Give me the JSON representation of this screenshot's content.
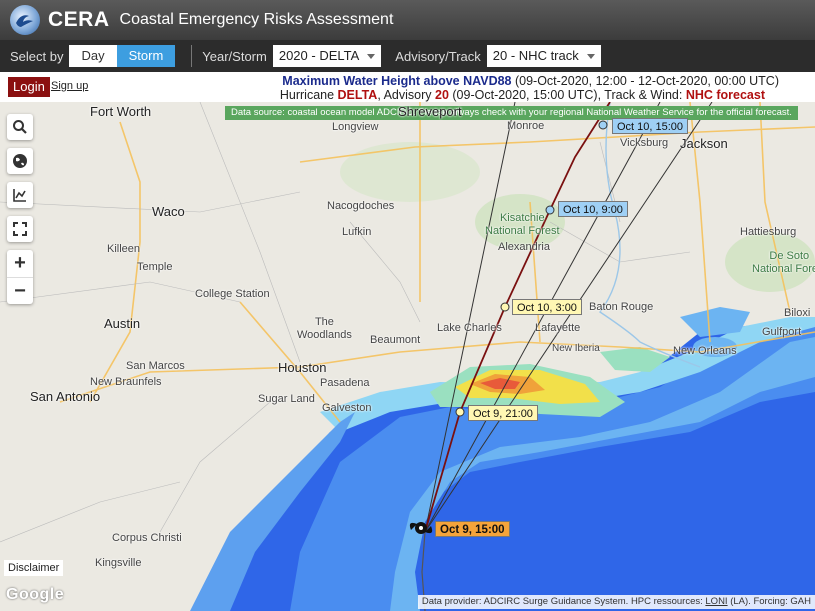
{
  "header": {
    "brand": "CERA",
    "subtitle": "Coastal Emergency Risks Assessment"
  },
  "toolbar": {
    "select_by_label": "Select by",
    "day_label": "Day",
    "storm_label": "Storm",
    "year_storm_label": "Year/Storm",
    "year_storm_value": "2020 - DELTA",
    "advisory_label": "Advisory/Track",
    "advisory_value": "20 - NHC track"
  },
  "infobar": {
    "login_label": "Login",
    "signup_label": "Sign up",
    "title_bold": "Maximum Water Height above NAVD88",
    "title_range": " (09-Oct-2020, 12:00 - 12-Oct-2020, 00:00 UTC)",
    "line2_prefix": "Hurricane ",
    "storm_name": "DELTA",
    "line2_mid": ", Advisory ",
    "advisory_num": "20",
    "line2_after": " (09-Oct-2020, 15:00 UTC), Track & Wind: ",
    "forecast_label": "NHC forecast"
  },
  "map": {
    "data_source": "Data source: coastal ocean model ADCIRC. Please always check with your regional National Weather Service for the official forecast.",
    "controls": [
      "search-icon",
      "globe-icon",
      "chart-icon",
      "fullscreen-icon"
    ],
    "zoom_in": "+",
    "zoom_out": "−",
    "cities": {
      "fort_worth": "Fort Worth",
      "shreveport": "Shreveport",
      "monroe": "Monroe",
      "vicksburg": "Vicksburg",
      "jackson": "Jackson",
      "longview": "Longview",
      "waco": "Waco",
      "nacogdoches": "Nacogdoches",
      "lufkin": "Lufkin",
      "kisatchie": "Kisatchie\nNational Forest",
      "alexandria": "Alexandria",
      "hattiesburg": "Hattiesburg",
      "desoto": "De Soto\nNational Forest",
      "killeen": "Killeen",
      "temple": "Temple",
      "college_station": "College Station",
      "austin": "Austin",
      "woodlands": "The\nWoodlands",
      "lake_charles": "Lake Charles",
      "lafayette": "Lafayette",
      "baton_rouge": "Baton Rouge",
      "biloxi": "Biloxi",
      "gulfport": "Gulfport",
      "beaumont": "Beaumont",
      "new_iberia": "New Iberia",
      "new_orleans": "New Orleans",
      "san_marcos": "San Marcos",
      "new_braunfels": "New Braunfels",
      "houston": "Houston",
      "pasadena": "Pasadena",
      "sugar_land": "Sugar Land",
      "san_antonio": "San Antonio",
      "galveston": "Galveston",
      "corpus_christi": "Corpus Christi",
      "kingsville": "Kingsville"
    },
    "track_labels": {
      "oct10_15": "Oct 10, 15:00",
      "oct10_9": "Oct 10, 9:00",
      "oct10_3": "Oct 10, 3:00",
      "oct9_21": "Oct 9, 21:00",
      "oct9_15": "Oct 9, 15:00"
    },
    "disclaimer": "Disclaimer",
    "google": "Google",
    "provider_prefix": "Data provider: ADCIRC Surge Guidance System. HPC ressources: ",
    "provider_loni": "LONI",
    "provider_suffix": " (LA). Forcing: GAH",
    "colors": {
      "ocean_deep": "#2f66e8",
      "ocean_mid": "#4a8df0",
      "ocean_shelf": "#6cb4f2",
      "surge_high": "#e85a3a",
      "surge_mid": "#f2e04a",
      "track": "#7a1010"
    }
  }
}
